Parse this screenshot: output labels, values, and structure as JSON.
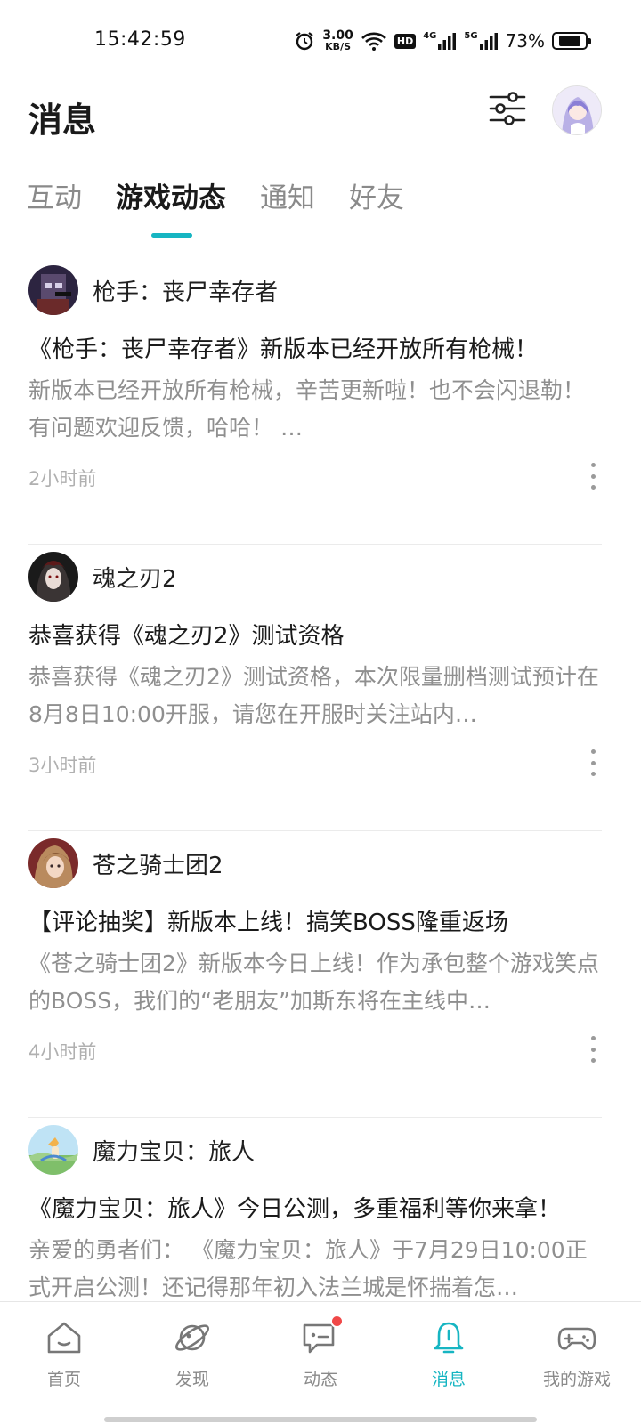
{
  "status_bar": {
    "time": "15:42:59",
    "net_speed_value": "3.00",
    "net_speed_unit": "KB/S",
    "hd_label": "HD",
    "signal1_label": "4G",
    "signal2_label": "5G",
    "battery_percent": "73%",
    "battery_level": 0.73,
    "icons": [
      "alarm-icon",
      "wifi-icon",
      "signal-icon",
      "battery-icon"
    ]
  },
  "header": {
    "title": "消息",
    "filter_icon": "filter-sliders-icon",
    "avatar": "user-avatar"
  },
  "tabs": [
    {
      "label": "互动",
      "active": false
    },
    {
      "label": "游戏动态",
      "active": true
    },
    {
      "label": "通知",
      "active": false
    },
    {
      "label": "好友",
      "active": false
    }
  ],
  "feed": [
    {
      "game": "枪手：丧尸幸存者",
      "title": "《枪手：丧尸幸存者》新版本已经开放所有枪械！",
      "body": "新版本已经开放所有枪械，辛苦更新啦！也不会闪退勒！ 有问题欢迎反馈，哈哈！ …",
      "time": "2小时前"
    },
    {
      "game": "魂之刃2",
      "title": "恭喜获得《魂之刃2》测试资格",
      "body": "恭喜获得《魂之刃2》测试资格，本次限量删档测试预计在8月8日10:00开服，请您在开服时关注站内…",
      "time": "3小时前"
    },
    {
      "game": "苍之骑士团2",
      "title": "【评论抽奖】新版本上线！搞笑BOSS隆重返场",
      "body": "《苍之骑士团2》新版本今日上线！作为承包整个游戏笑点的BOSS，我们的“老朋友”加斯东将在主线中…",
      "time": "4小时前"
    },
    {
      "game": "魔力宝贝：旅人",
      "title": "《魔力宝贝：旅人》今日公测，多重福利等你来拿！",
      "body": "亲爱的勇者们：  《魔力宝贝：旅人》于7月29日10:00正式开启公测！还记得那年初入法兰城是怀揣着怎…",
      "time": ""
    }
  ],
  "bottom_nav": [
    {
      "label": "首页",
      "icon": "home-icon",
      "active": false
    },
    {
      "label": "发现",
      "icon": "planet-icon",
      "active": false
    },
    {
      "label": "动态",
      "icon": "chat-icon",
      "active": false,
      "badge_dot": true
    },
    {
      "label": "消息",
      "icon": "bell-icon",
      "active": true
    },
    {
      "label": "我的游戏",
      "icon": "gamepad-icon",
      "active": false
    }
  ],
  "colors": {
    "accent": "#16b5c2",
    "badge_red": "#f04848",
    "text_primary": "#1a1a1a",
    "text_secondary": "#8f8f8f",
    "text_muted": "#b0b0b0"
  }
}
